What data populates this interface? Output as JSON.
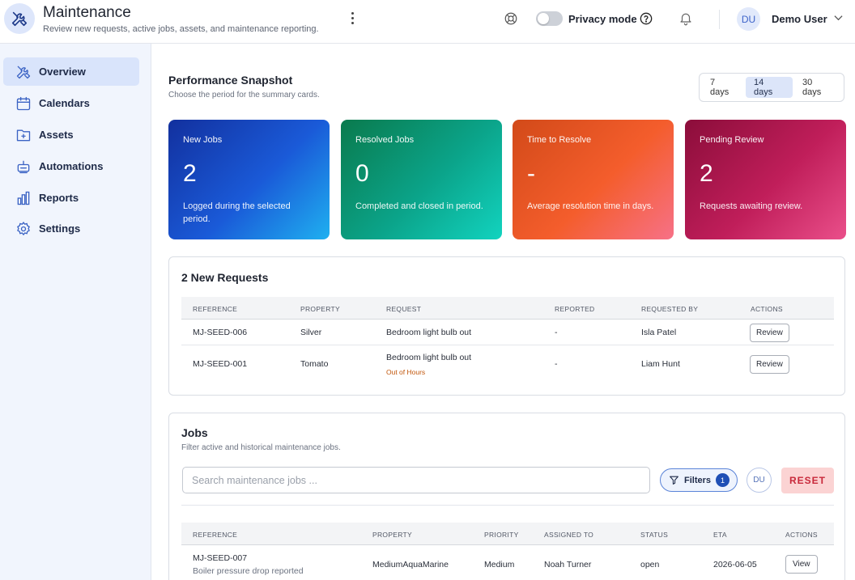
{
  "header": {
    "title": "Maintenance",
    "subtitle": "Review new requests, active jobs, assets, and maintenance reporting.",
    "privacy_label": "Privacy mode",
    "user_initials": "DU",
    "user_name": "Demo User"
  },
  "sidebar": {
    "items": [
      {
        "label": "Overview",
        "icon": "tools-icon",
        "active": true
      },
      {
        "label": "Calendars",
        "icon": "calendar-icon"
      },
      {
        "label": "Assets",
        "icon": "assets-icon"
      },
      {
        "label": "Automations",
        "icon": "automation-icon"
      },
      {
        "label": "Reports",
        "icon": "bar-chart-icon"
      },
      {
        "label": "Settings",
        "icon": "gear-icon"
      }
    ]
  },
  "snapshot": {
    "title": "Performance Snapshot",
    "subtitle": "Choose the period for the summary cards.",
    "ranges": [
      "7 days",
      "14 days",
      "30 days"
    ],
    "selected_range": "14 days",
    "cards": [
      {
        "label": "New Jobs",
        "value": "2",
        "desc": "Logged during the selected period."
      },
      {
        "label": "Resolved Jobs",
        "value": "0",
        "desc": "Completed and closed in period."
      },
      {
        "label": "Time to Resolve",
        "value": "-",
        "desc": "Average resolution time in days."
      },
      {
        "label": "Pending Review",
        "value": "2",
        "desc": "Requests awaiting review."
      }
    ]
  },
  "requests": {
    "title": "2 New Requests",
    "columns": [
      "REFERENCE",
      "PROPERTY",
      "REQUEST",
      "REPORTED",
      "REQUESTED BY",
      "ACTIONS"
    ],
    "rows": [
      {
        "reference": "MJ-SEED-006",
        "property": "Silver",
        "request": "Bedroom light bulb out",
        "tag": "",
        "reported": "-",
        "requested_by": "Isla Patel",
        "action": "Review"
      },
      {
        "reference": "MJ-SEED-001",
        "property": "Tomato",
        "request": "Bedroom light bulb out",
        "tag": "Out of Hours",
        "reported": "-",
        "requested_by": "Liam Hunt",
        "action": "Review"
      }
    ]
  },
  "jobs": {
    "title": "Jobs",
    "subtitle": "Filter active and historical maintenance jobs.",
    "search_placeholder": "Search maintenance jobs ...",
    "filters_label": "Filters",
    "filters_count": "1",
    "user_chip": "DU",
    "reset_label": "RESET",
    "columns": [
      "REFERENCE",
      "PROPERTY",
      "PRIORITY",
      "ASSIGNED TO",
      "STATUS",
      "ETA",
      "ACTIONS"
    ],
    "rows": [
      {
        "reference": "MJ-SEED-007",
        "description": "Boiler pressure drop reported",
        "property": "MediumAquaMarine",
        "priority": "Medium",
        "assigned_to": "Noah Turner",
        "status": "open",
        "eta": "2026-06-05",
        "action": "View"
      }
    ]
  }
}
